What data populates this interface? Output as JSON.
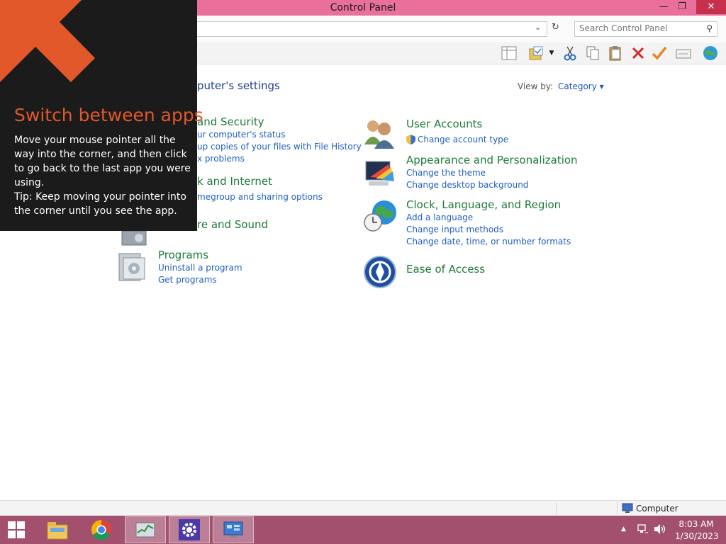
{
  "window": {
    "title": "Control Panel",
    "minimize": "—",
    "maximize": "❐",
    "close": "✕"
  },
  "address": {
    "search_placeholder": "Search Control Panel"
  },
  "content": {
    "heading": "puter's settings",
    "view_by_label": "View by:",
    "view_by_value": "Category ▾"
  },
  "left_categories": [
    {
      "title": "and Security",
      "links": [
        "ur computer's status",
        "up copies of your files with File History",
        "x problems"
      ]
    },
    {
      "title": "k and Internet",
      "links": [
        "megroup and sharing options"
      ]
    },
    {
      "title": "re and Sound",
      "links": []
    },
    {
      "title": "Programs",
      "links": [
        "Uninstall a program",
        "Get programs"
      ]
    }
  ],
  "right_categories": [
    {
      "title": "User Accounts",
      "links": [
        "Change account type"
      ]
    },
    {
      "title": "Appearance and Personalization",
      "links": [
        "Change the theme",
        "Change desktop background"
      ]
    },
    {
      "title": "Clock, Language, and Region",
      "links": [
        "Add a language",
        "Change input methods",
        "Change date, time, or number formats"
      ]
    },
    {
      "title": "Ease of Access",
      "links": []
    }
  ],
  "status": {
    "location": "Computer"
  },
  "taskbar": {
    "time": "8:03 AM",
    "date": "1/30/2023"
  },
  "overlay": {
    "title": "Switch between apps",
    "body": "Move your mouse pointer all the way into the corner, and then click to go back to the last app you were using.",
    "tip": "Tip: Keep moving your pointer into the corner until you see the app."
  },
  "colors": {
    "titlebar": "#e8709a",
    "taskbar": "#a2506e",
    "overlay_accent": "#e2582a",
    "link": "#1f5fbf",
    "category_title": "#1e7a3a"
  }
}
